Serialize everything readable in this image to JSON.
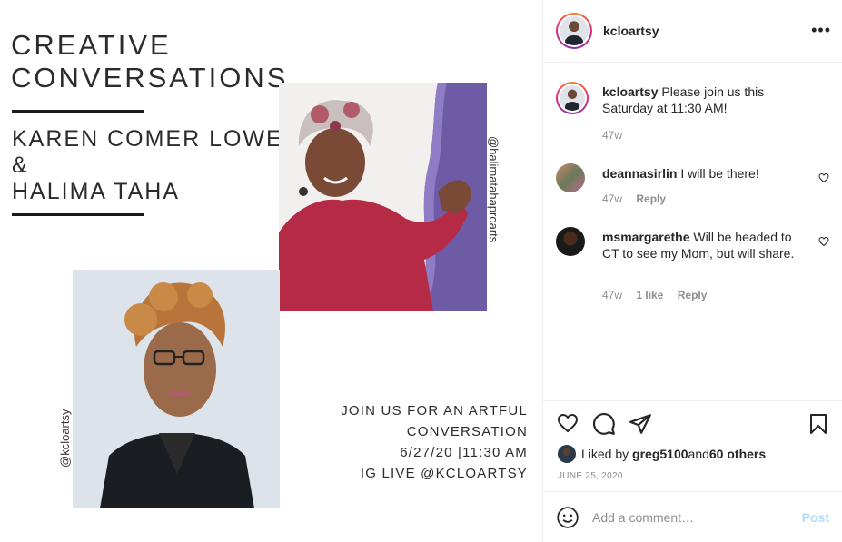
{
  "image": {
    "headline": [
      "CREATIVE",
      "CONVERSATIONS"
    ],
    "names": [
      "KAREN COMER LOWE",
      "&",
      "HALIMA TAHA"
    ],
    "handle_right": "@halimatahaproarts",
    "handle_left": "@kcloartsy",
    "event_lines": [
      "JOIN US FOR AN ARTFUL",
      "CONVERSATION",
      "6/27/20 |11:30 AM",
      "IG LIVE @KCLOARTSY"
    ]
  },
  "header": {
    "username": "kcloartsy",
    "more": "•••"
  },
  "caption": {
    "username": "kcloartsy",
    "text": " Please join us this Saturday at 11:30 AM!",
    "time": "47w"
  },
  "comments": [
    {
      "username": "deannasirlin",
      "text": " I will be there!",
      "time": "47w",
      "likes": "",
      "reply": "Reply"
    },
    {
      "username": "msmargarethe",
      "text": " Will be headed to CT to see my Mom, but will share.",
      "time": "47w",
      "likes": "1 like",
      "reply": "Reply"
    }
  ],
  "likes": {
    "prefix": "Liked by ",
    "user": "greg5100",
    "middle": " and ",
    "others": "60 others"
  },
  "date": "JUNE 25, 2020",
  "add_comment": {
    "placeholder": "Add a comment…",
    "post": "Post"
  },
  "colors": {
    "accent_link": "#b3dbff",
    "muted": "#8e8e8e",
    "text": "#262626"
  }
}
